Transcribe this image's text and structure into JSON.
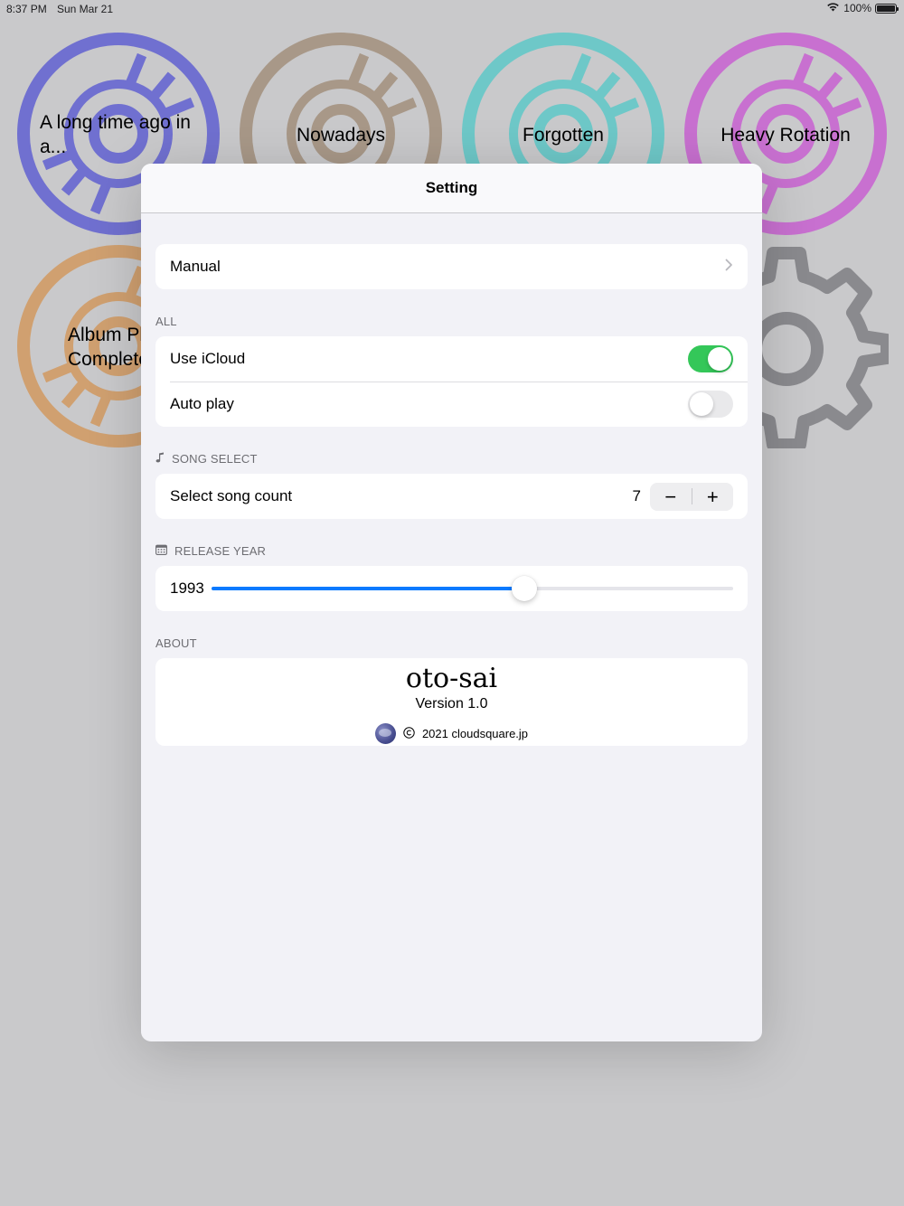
{
  "status_bar": {
    "time": "8:37 PM",
    "date": "Sun Mar 21",
    "battery": "100%"
  },
  "background": {
    "discs": [
      {
        "label": "A long time ago in a...",
        "color": "#7070d0"
      },
      {
        "label": "Nowadays",
        "color": "#a89888"
      },
      {
        "label": "Forgotten",
        "color": "#6ec8c8"
      },
      {
        "label": "Heavy Rotation",
        "color": "#c870d0"
      },
      {
        "label": "Album Play Complete",
        "color": "#d0a070"
      }
    ],
    "gear_icon": "gear-icon"
  },
  "modal": {
    "title": "Setting",
    "manual_label": "Manual",
    "sections": {
      "all": "ALL",
      "song_select": "SONG SELECT",
      "release_year": "RELEASE YEAR",
      "about": "ABOUT"
    },
    "use_icloud": {
      "label": "Use iCloud",
      "on": true
    },
    "auto_play": {
      "label": "Auto play",
      "on": false
    },
    "song_count": {
      "label": "Select song count",
      "value": "7",
      "minus": "−",
      "plus": "+"
    },
    "release_year": {
      "value": "1993",
      "fraction": 0.6
    },
    "about": {
      "app_name": "oto-sai",
      "version": "Version 1.0",
      "copyright": "2021 cloudsquare.jp"
    }
  },
  "colors": {
    "toggle_on": "#34c759",
    "slider": "#0a7aff"
  }
}
